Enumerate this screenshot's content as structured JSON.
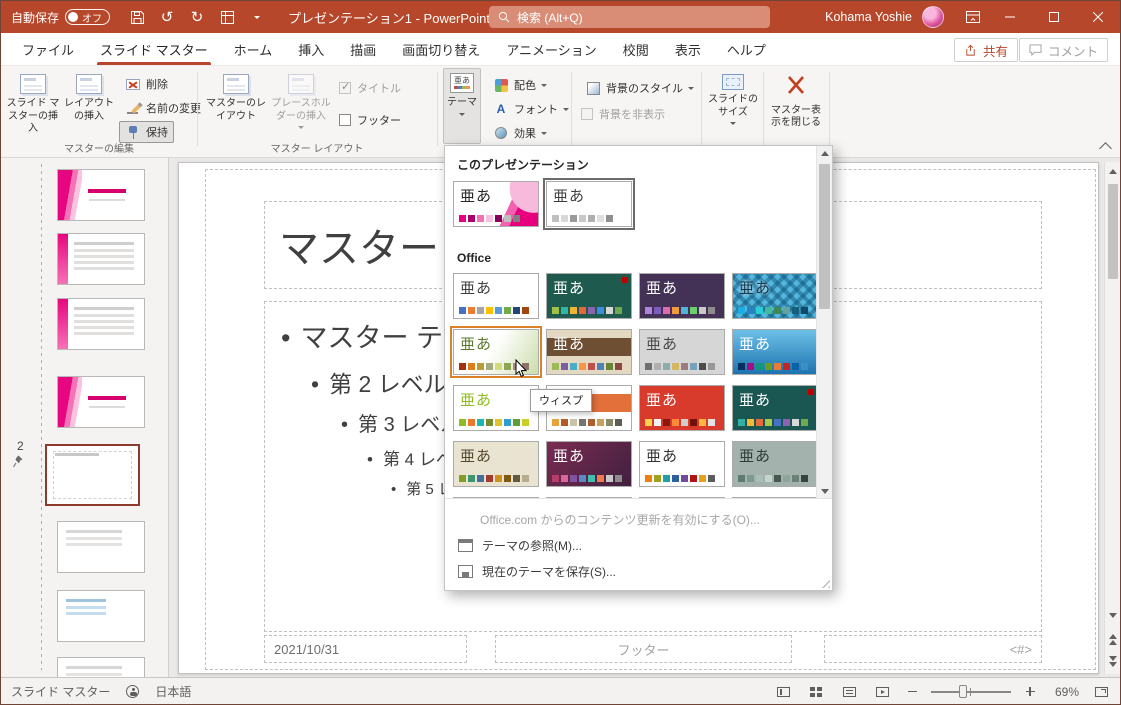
{
  "colors": {
    "titlebar": "#B7472A",
    "accent": "#B7472A",
    "search_bg": "#D98D76"
  },
  "titlebar": {
    "autosave_label": "自動保存",
    "autosave_state": "オフ",
    "document_title": "プレゼンテーション1 - PowerPoint",
    "search_placeholder": "検索 (Alt+Q)",
    "user_name": "Kohama Yoshie"
  },
  "ribbon": {
    "tabs": [
      {
        "label": "ファイル",
        "active": false
      },
      {
        "label": "スライド マスター",
        "active": true
      },
      {
        "label": "ホーム",
        "active": false
      },
      {
        "label": "挿入",
        "active": false
      },
      {
        "label": "描画",
        "active": false
      },
      {
        "label": "画面切り替え",
        "active": false
      },
      {
        "label": "アニメーション",
        "active": false
      },
      {
        "label": "校閲",
        "active": false
      },
      {
        "label": "表示",
        "active": false
      },
      {
        "label": "ヘルプ",
        "active": false
      }
    ],
    "share_label": "共有",
    "comments_label": "コメント",
    "master_edit": {
      "group_label": "マスターの編集",
      "insert_master": "スライド マスターの挿入",
      "insert_layout": "レイアウトの挿入",
      "delete": "削除",
      "rename": "名前の変更",
      "preserve": "保持"
    },
    "master_layout": {
      "group_label": "マスター レイアウト",
      "master_layout_btn": "マスターのレイアウト",
      "insert_placeholder": "プレースホルダーの挿入",
      "title_checkbox": "タイトル",
      "footer_checkbox": "フッター"
    },
    "themes_group": {
      "theme_btn": "テーマ",
      "colors_btn": "配色",
      "fonts_btn": "フォント",
      "effects_btn": "効果"
    },
    "background_group": {
      "bg_styles": "背景のスタイル",
      "hide_bg": "背景を非表示"
    },
    "size_group": {
      "slide_size": "スライドのサイズ"
    },
    "close_group": {
      "close_master": "マスター表示を閉じる"
    }
  },
  "themes": {
    "section_current": "このプレゼンテーション",
    "section_office": "Office",
    "sample_text": "亜あ",
    "tooltip": "ウィスプ",
    "current": [
      {
        "bg": "#FFFFFF",
        "fg": "#262626",
        "decor": "decor-pink",
        "swatches": [
          "#E6007E",
          "#AB0069",
          "#F272B2",
          "#F9BFDE",
          "#87005B",
          "#BFBFBF",
          "#7F7F7F"
        ]
      },
      {
        "bg": "#FFFFFF",
        "fg": "#3F3F3F",
        "selected": true,
        "swatches": [
          "#BFBFBF",
          "#D8D8D8",
          "#9A9A9A",
          "#C8C8C8",
          "#AFAFAF",
          "#E0E0E0",
          "#8F8F8F"
        ]
      }
    ],
    "office": [
      {
        "bg": "#FFFFFF",
        "fg": "#3F3F3F",
        "swatches": [
          "#4472C4",
          "#ED7D31",
          "#A5A5A5",
          "#FFC000",
          "#5B9BD5",
          "#70AD47",
          "#264478",
          "#9E480E"
        ]
      },
      {
        "bg": "#1E5A4E",
        "fg": "#FFFFFF",
        "accent": "#C00000",
        "swatches": [
          "#A2C046",
          "#31B6A9",
          "#F2B431",
          "#E8663C",
          "#8C63B0",
          "#3E8DDD",
          "#D8D8D8",
          "#6FA84F"
        ]
      },
      {
        "bg": "#433156",
        "fg": "#FFFFFF",
        "swatches": [
          "#AE84DC",
          "#7C5CBF",
          "#E06AB0",
          "#EF9A3C",
          "#52B3D9",
          "#6BCF6B",
          "#C9C9C9",
          "#8C8C8C"
        ]
      },
      {
        "pattern": true,
        "fg": "#0E3A52",
        "swatches": [
          "#1CADE4",
          "#2683C6",
          "#27CED7",
          "#42BA97",
          "#3E8853",
          "#62A39F",
          "#145E7E",
          "#0E4B66"
        ]
      },
      {
        "bg": "linear-gradient(120deg,#FFFFFF 45%,#E4EDD3 75%,#CBDDA8 100%)",
        "fg": "#5A7A2B",
        "hover": true,
        "swatches": [
          "#A53010",
          "#DE7E18",
          "#B99C38",
          "#A5AB81",
          "#D2DA7A",
          "#8BA753",
          "#B88472",
          "#8E736A"
        ]
      },
      {
        "bg": "#E3D8C1",
        "fg": "#FFFFFF",
        "band": "#6E4F33",
        "swatches": [
          "#9CBB58",
          "#7D5BA6",
          "#4BACC6",
          "#F79646",
          "#C0504D",
          "#4F81BD",
          "#698436",
          "#8C4646"
        ]
      },
      {
        "bg": "#D6D6D6",
        "fg": "#4A4A4A",
        "swatches": [
          "#6F6F6F",
          "#B0B0B0",
          "#8CADAE",
          "#D6B55F",
          "#9C7C7C",
          "#77A2BB",
          "#4D4D4D",
          "#989898"
        ]
      },
      {
        "bg": "linear-gradient(180deg,#6CC0E8,#1E74B0)",
        "fg": "#FFFFFF",
        "swatches": [
          "#052F61",
          "#A50E82",
          "#14967C",
          "#6A9E1F",
          "#E87D37",
          "#C62324",
          "#0C62A6",
          "#3D8EC4"
        ]
      },
      {
        "bg": "#FFFFFF",
        "fg": "#90BB23",
        "swatches": [
          "#90BB23",
          "#EC7728",
          "#1AB6B6",
          "#748E2E",
          "#DEC32E",
          "#2E9ECE",
          "#5E9E38",
          "#C8CF2A"
        ]
      },
      {
        "bg": "#FFFFFF",
        "fg": "#FFFFFF",
        "band": "#E2703A",
        "swatches": [
          "#E8A33D",
          "#B85A24",
          "#C9C2A8",
          "#77746C",
          "#AD5F2C",
          "#C8A05F",
          "#8A8A6A",
          "#5E5E50"
        ]
      },
      {
        "bg": "#D83B2C",
        "fg": "#FFFFFF",
        "swatches": [
          "#FFD24C",
          "#F2F2F2",
          "#8A1711",
          "#FF8A3C",
          "#CFCFCF",
          "#731008",
          "#FFB63C",
          "#E2E2E2"
        ]
      },
      {
        "bg": "#1A5752",
        "fg": "#FFFFFF",
        "accent": "#C00000",
        "swatches": [
          "#33B0A6",
          "#F5B935",
          "#E66C3C",
          "#A7C94C",
          "#4472C4",
          "#8C63B0",
          "#D8D8D8",
          "#6FA84F"
        ]
      },
      {
        "bg": "#E9E3D2",
        "fg": "#55492E",
        "swatches": [
          "#83992A",
          "#3C9670",
          "#44709D",
          "#A23C33",
          "#D0901E",
          "#81580F",
          "#66573F",
          "#B8AB8F"
        ]
      },
      {
        "bg": "linear-gradient(135deg,#7A2C52,#41203F)",
        "fg": "#FFFFFF",
        "swatches": [
          "#B83D68",
          "#D9659A",
          "#8253A0",
          "#5C88C5",
          "#40BFB0",
          "#EE7B4D",
          "#C9C9C9",
          "#8C8C8C"
        ]
      },
      {
        "bg": "#FFFFFF",
        "fg": "#333333",
        "swatches": [
          "#F07F09",
          "#9FA11F",
          "#1FA0A8",
          "#2E5E9C",
          "#6F4C9B",
          "#B01513",
          "#E2A219",
          "#5C5C5C"
        ]
      },
      {
        "bg": "#A3B2AC",
        "fg": "#2F3B37",
        "swatches": [
          "#5D7A73",
          "#7E998F",
          "#A9BFB6",
          "#C5D4CC",
          "#46594F",
          "#8FA59B",
          "#6B8278",
          "#39443E"
        ]
      },
      {
        "bg": "#F2F2F2",
        "fg": "#444444",
        "swatches": [
          "#888888"
        ]
      },
      {
        "bg": "#5E1B3C",
        "fg": "#FFFFFF",
        "swatches": [
          "#B05577"
        ]
      },
      {
        "bg": "#2C7C74",
        "fg": "#FFFFFF",
        "swatches": [
          "#7FB8B2"
        ]
      },
      {
        "bg": "#353F49",
        "fg": "#FFFFFF",
        "swatches": [
          "#8A99A8"
        ]
      }
    ],
    "footer_items": [
      {
        "label": "Office.com からのコンテンツ更新を有効にする(O)...",
        "disabled": true
      },
      {
        "label": "テーマの参照(M)...",
        "icon": "browse-themes-icon"
      },
      {
        "label": "現在のテーマを保存(S)...",
        "icon": "save-theme-icon"
      }
    ]
  },
  "sidebar": {
    "selected_number": "2",
    "thumbnails": [
      {
        "variant": "pink-title"
      },
      {
        "variant": "pink-content"
      },
      {
        "variant": "pink-content"
      },
      {
        "variant": "pink-title"
      },
      {
        "variant": "master-sel",
        "selected": true
      },
      {
        "variant": "white-a"
      },
      {
        "variant": "white-b"
      },
      {
        "variant": "white-a"
      }
    ]
  },
  "slide": {
    "title": "マスター タイトルの書式設定",
    "bullets": [
      {
        "level": 1,
        "text": "マスター テキストの書式設定"
      },
      {
        "level": 2,
        "text": "第 2 レベル"
      },
      {
        "level": 3,
        "text": "第 3 レベル"
      },
      {
        "level": 4,
        "text": "第 4 レベル"
      },
      {
        "level": 5,
        "text": "第 5 レベル"
      }
    ],
    "date": "2021/10/31",
    "footer": "フッター",
    "number": "<#>"
  },
  "statusbar": {
    "view_label": "スライド マスター",
    "language": "日本語",
    "zoom": "69%"
  }
}
